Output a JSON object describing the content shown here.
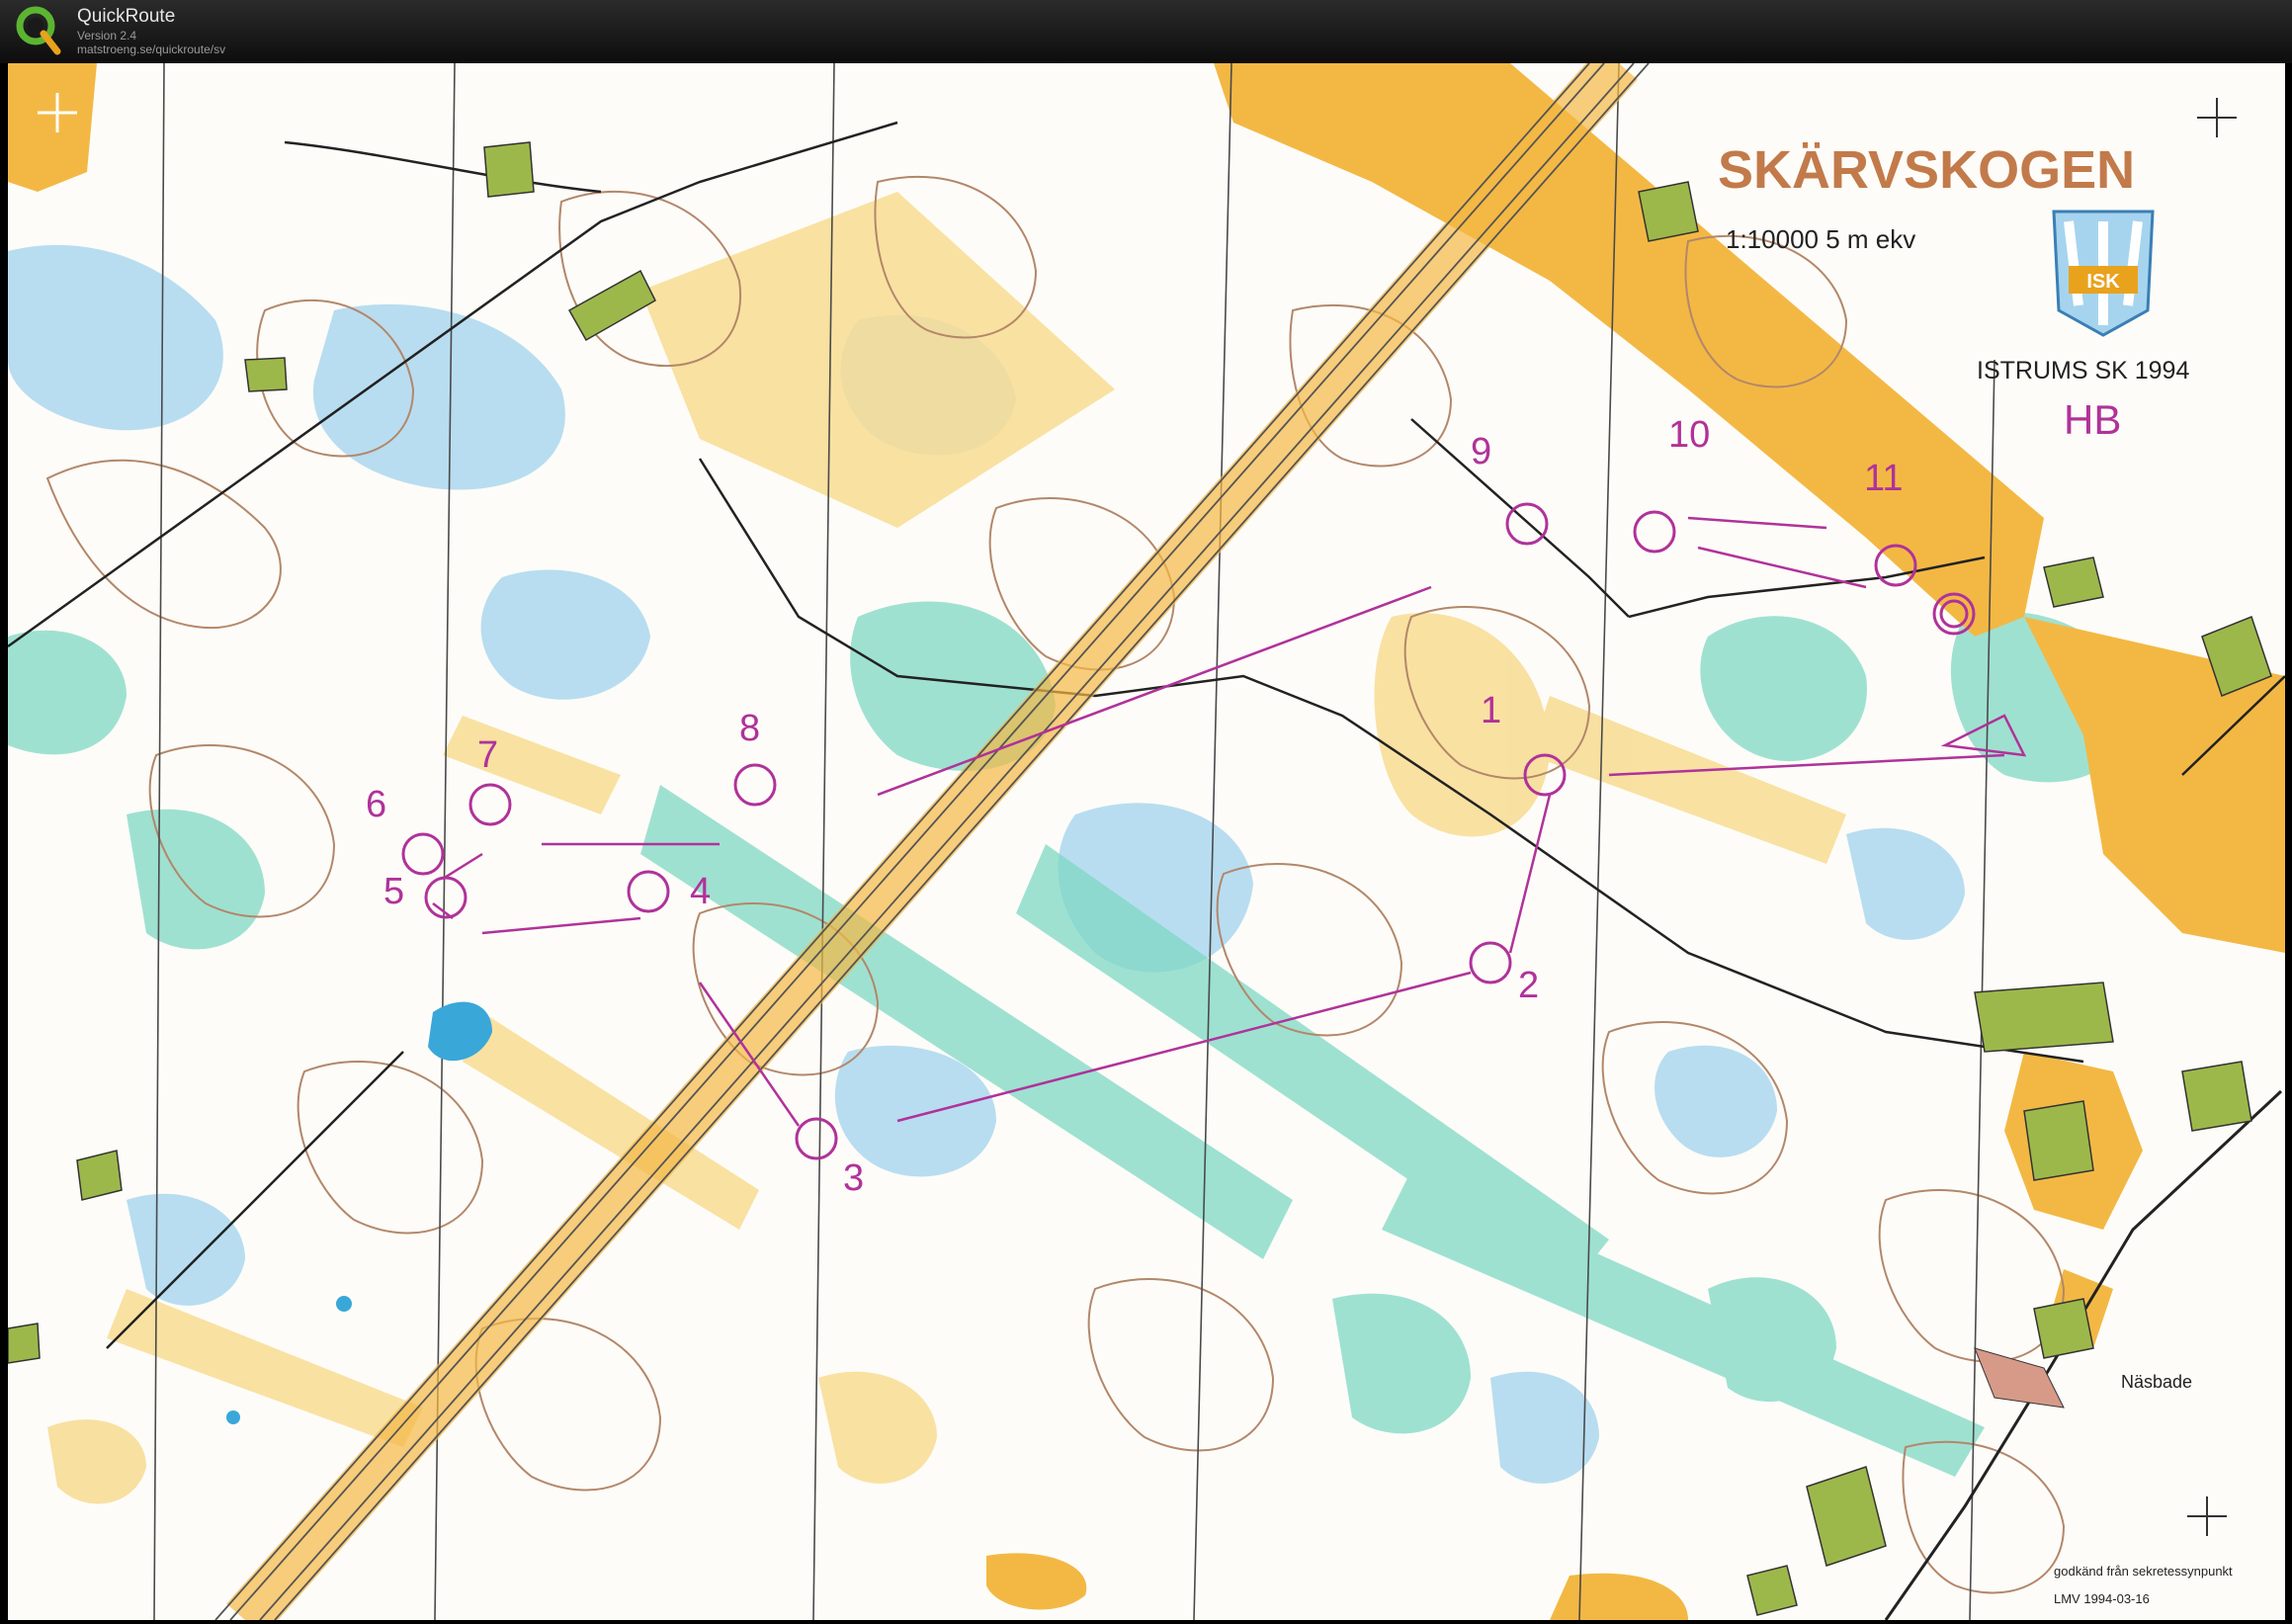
{
  "app": {
    "name": "QuickRoute",
    "version": "Version 2.4",
    "url": "matstroeng.se/quickroute/sv"
  },
  "map": {
    "title": "SKÄRVSKOGEN",
    "scale": "1:10000  5 m ekv",
    "club": "ISTRUMS SK  1994",
    "runner_initials": "HB",
    "logo_text": "ISK",
    "place_name": "Näsbade",
    "approval_note": "godkänd från sekretessynpunkt",
    "approval_ref": "LMV 1994-03-16",
    "controls": [
      "1",
      "2",
      "3",
      "4",
      "5",
      "6",
      "7",
      "8",
      "9",
      "10",
      "11"
    ],
    "colors": {
      "open_land": "#f3b844",
      "rough_open": "#f8dc92",
      "vegetation_green": "#7fd8c4",
      "marsh_blue": "#a6d4ee",
      "water": "#3aa7d9",
      "contour_brown": "#b3876a",
      "course_purple": "#b0329a",
      "settlement_green": "#9db84a",
      "title_brown": "#c27a4a"
    }
  }
}
